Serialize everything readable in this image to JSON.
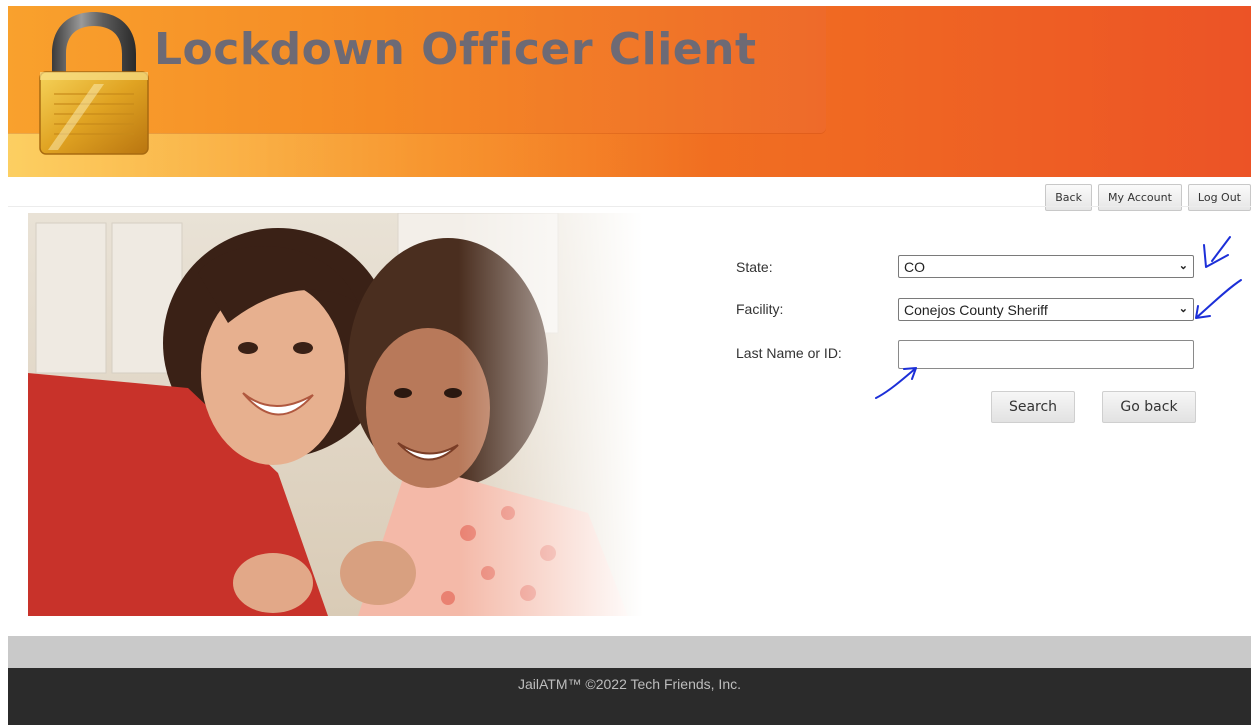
{
  "header": {
    "app_title": "Lockdown Officer Client",
    "logo_icon": "padlock-icon"
  },
  "toolbar": {
    "back_label": "Back",
    "my_account_label": "My Account",
    "log_out_label": "Log Out"
  },
  "photo": {
    "description_icon": "mother-daughter-photo"
  },
  "form": {
    "state_label": "State:",
    "state_value": "CO",
    "facility_label": "Facility:",
    "facility_value": "Conejos County Sheriff",
    "last_name_label": "Last Name or ID:",
    "last_name_value": "",
    "search_label": "Search",
    "go_back_label": "Go back"
  },
  "footer": {
    "copyright": "JailATM™ ©2022 Tech Friends, Inc."
  },
  "colors": {
    "header_orange": "#f37a1e",
    "annotation_blue": "#1c2fd8",
    "footer_dark": "#2b2b2b"
  }
}
